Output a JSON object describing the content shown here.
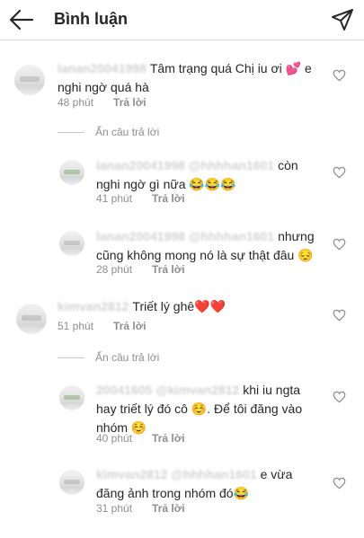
{
  "header": {
    "title": "Bình luận"
  },
  "comments": [
    {
      "username": "lanan20041998",
      "text": "Tâm trạng quá Chị iu ơi 💕 e nghi ngờ quá hà",
      "time": "48 phút",
      "reply": "Trả lời"
    },
    {
      "username": "lanan20041998 @hhhhan1601",
      "text": "còn nghi ngờ gì nữa 😂😂😂",
      "time": "41 phút",
      "reply": "Trả lời"
    },
    {
      "username": "lanan20041998 @hhhhan1601",
      "text": "nhưng cũng không mong nó là sự thật đâu 😔",
      "time": "28 phút",
      "reply": "Trả lời"
    },
    {
      "username": "kimvan2812",
      "text": "Triết lý ghê❤️❤️",
      "time": "51 phút",
      "reply": "Trả lời"
    },
    {
      "username": "20041605 @kimvan2812",
      "text": "khi iu ngta hay triết lý đó cô ☺️. Để tôi đăng vào nhóm ☺️",
      "time": "40 phút",
      "reply": "Trả lời"
    },
    {
      "username": "kimvan2812 @hhhhan1601",
      "text": "e vừa đăng ảnh trong nhóm đó😂",
      "time": "31 phút",
      "reply": "Trả lời"
    }
  ],
  "hide_replies_label": "Ẩn câu trả lời",
  "colors": {
    "text": "#262626",
    "muted": "#8e8e8e",
    "border": "#dbdbdb"
  }
}
